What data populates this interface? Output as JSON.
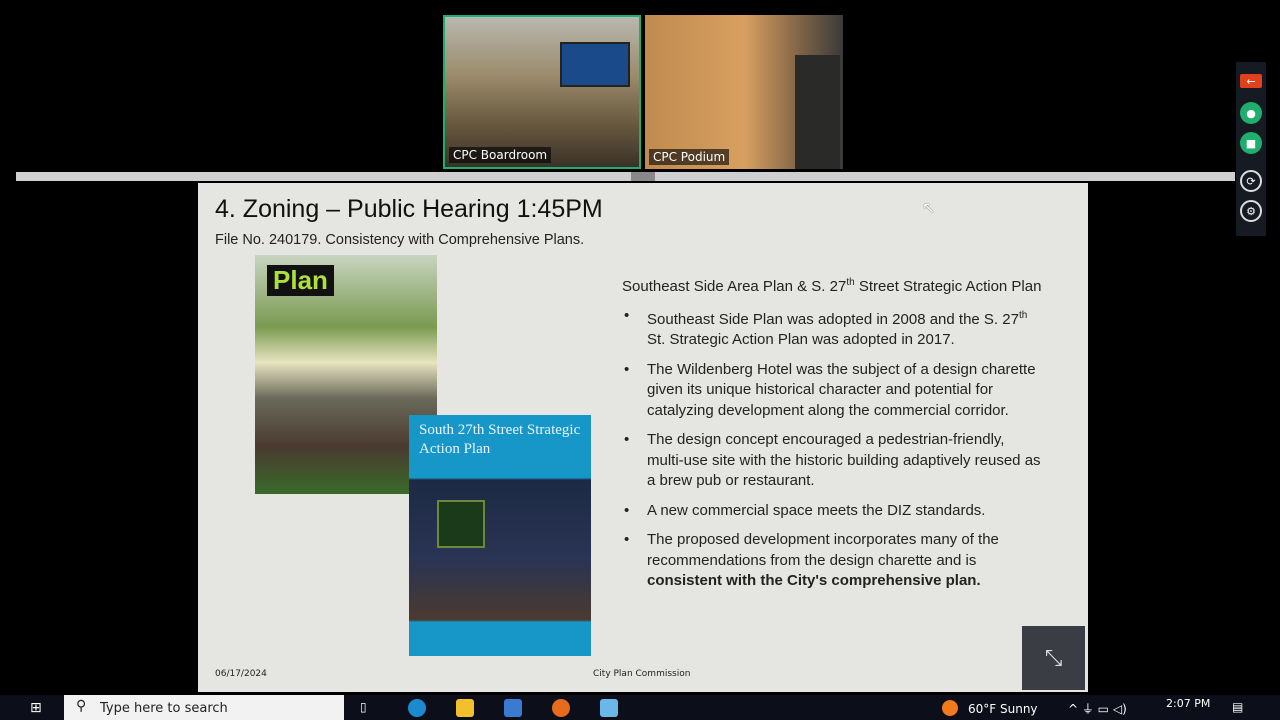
{
  "video": {
    "tiles": [
      {
        "label": "CPC Boardroom",
        "active": true
      },
      {
        "label": "CPC Podium",
        "active": false
      }
    ]
  },
  "slide": {
    "title": "4. Zoning – Public Hearing 1:45PM",
    "subtitle": "File No. 240179. Consistency with Comprehensive Plans.",
    "cover1": {
      "logo": "Plan"
    },
    "cover2": {
      "title": "South 27th Street Strategic Action Plan"
    },
    "heading_a": "Southeast Side Area Plan & S. 27",
    "heading_sup": "th",
    "heading_b": " Street Strategic Action Plan",
    "bullets": [
      {
        "a": "Southeast Side Plan was adopted in 2008 and the S. 27",
        "sup": "th",
        "b": " St. Strategic Action Plan was adopted in 2017."
      },
      {
        "text": "The Wildenberg Hotel was the subject of a design charette given its unique historical character and potential for catalyzing development along the commercial corridor."
      },
      {
        "text": "The design concept encouraged a pedestrian-friendly, multi-use site with the historic building adaptively reused as a brew pub or restaurant."
      },
      {
        "text": "A new commercial space meets the DIZ standards."
      },
      {
        "text": "The proposed development incorporates many of the recommendations from the design charette and is ",
        "bold": "consistent with the City's comprehensive plan."
      }
    ],
    "date": "06/17/2024",
    "footer": "City Plan Commission"
  },
  "side_controls": {
    "icons": [
      "leave-icon",
      "mic-icon",
      "camera-icon",
      "share-icon",
      "settings-icon"
    ],
    "colors": {
      "leave": "#e0401c",
      "active": "#1fae6e"
    }
  },
  "taskbar": {
    "search_placeholder": "Type here to search",
    "weather": "60°F  Sunny",
    "time": "2:07 PM"
  }
}
